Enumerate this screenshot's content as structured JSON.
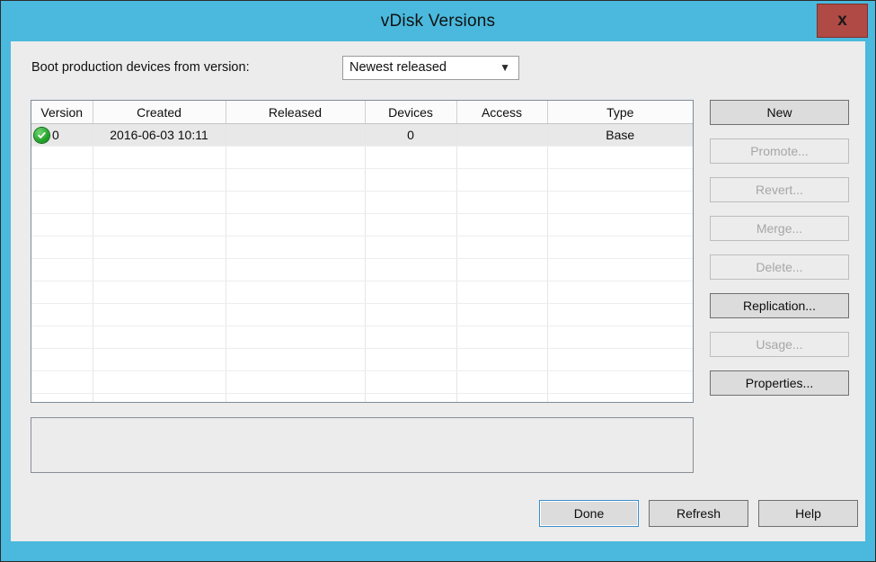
{
  "window": {
    "title": "vDisk Versions",
    "close_label": "x",
    "titlebar_color": "#4ab9dd",
    "close_button_color": "#b04a45",
    "body_color": "#ececec"
  },
  "boot_setting": {
    "label": "Boot production devices from version:",
    "selected": "Newest released",
    "arrow_icon": "chevron-down-icon"
  },
  "table": {
    "columns": [
      "Version",
      "Created",
      "Released",
      "Devices",
      "Access",
      "Type"
    ],
    "rows": [
      {
        "status_icon": "green-check-icon",
        "version": "0",
        "created": "2016-06-03 10:11",
        "released": "",
        "devices": "0",
        "access": "",
        "type": "Base",
        "selected": true
      }
    ],
    "empty_row_count": 12,
    "selected_row_color": "#e8e8e8"
  },
  "side_buttons": [
    {
      "label": "New",
      "enabled": true
    },
    {
      "label": "Promote...",
      "enabled": false
    },
    {
      "label": "Revert...",
      "enabled": false
    },
    {
      "label": "Merge...",
      "enabled": false
    },
    {
      "label": "Delete...",
      "enabled": false
    },
    {
      "label": "Replication...",
      "enabled": true
    },
    {
      "label": "Usage...",
      "enabled": false
    },
    {
      "label": "Properties...",
      "enabled": true
    }
  ],
  "description": {
    "text": ""
  },
  "bottom_buttons": {
    "done": "Done",
    "refresh": "Refresh",
    "help": "Help",
    "focus_color": "#3c8ecb"
  }
}
